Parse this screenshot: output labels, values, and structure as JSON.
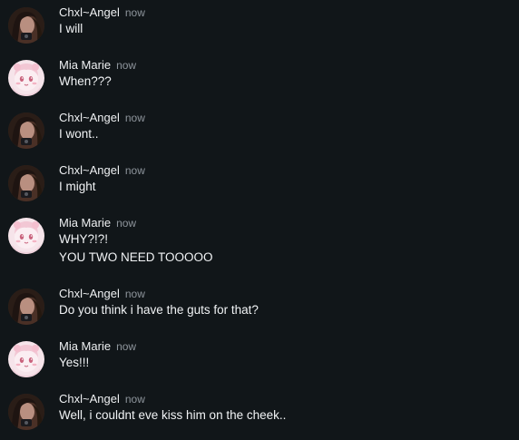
{
  "messages": [
    {
      "author": "Chxl~Angel",
      "avatar": "dark-hair-avatar",
      "timestamp": "now",
      "lines": [
        "I will"
      ]
    },
    {
      "author": "Mia Marie",
      "avatar": "pink-anime-avatar",
      "timestamp": "now",
      "lines": [
        "When???"
      ]
    },
    {
      "author": "Chxl~Angel",
      "avatar": "dark-hair-avatar",
      "timestamp": "now",
      "lines": [
        "I wont.."
      ]
    },
    {
      "author": "Chxl~Angel",
      "avatar": "dark-hair-avatar",
      "timestamp": "now",
      "lines": [
        "I might"
      ]
    },
    {
      "author": "Mia Marie",
      "avatar": "pink-anime-avatar",
      "timestamp": "now",
      "lines": [
        "WHY?!?!",
        "YOU TWO NEED TOOOOO"
      ]
    },
    {
      "author": "Chxl~Angel",
      "avatar": "dark-hair-avatar",
      "timestamp": "now",
      "lines": [
        "Do you think i have the guts for that?"
      ]
    },
    {
      "author": "Mia Marie",
      "avatar": "pink-anime-avatar",
      "timestamp": "now",
      "lines": [
        "Yes!!!"
      ]
    },
    {
      "author": "Chxl~Angel",
      "avatar": "dark-hair-avatar",
      "timestamp": "now",
      "lines": [
        "Well, i couldnt eve kiss him on the cheek.."
      ]
    }
  ],
  "colors": {
    "background": "#111619",
    "author": "#eef0f2",
    "timestamp": "#8e959c",
    "text": "#f1f3f5"
  }
}
